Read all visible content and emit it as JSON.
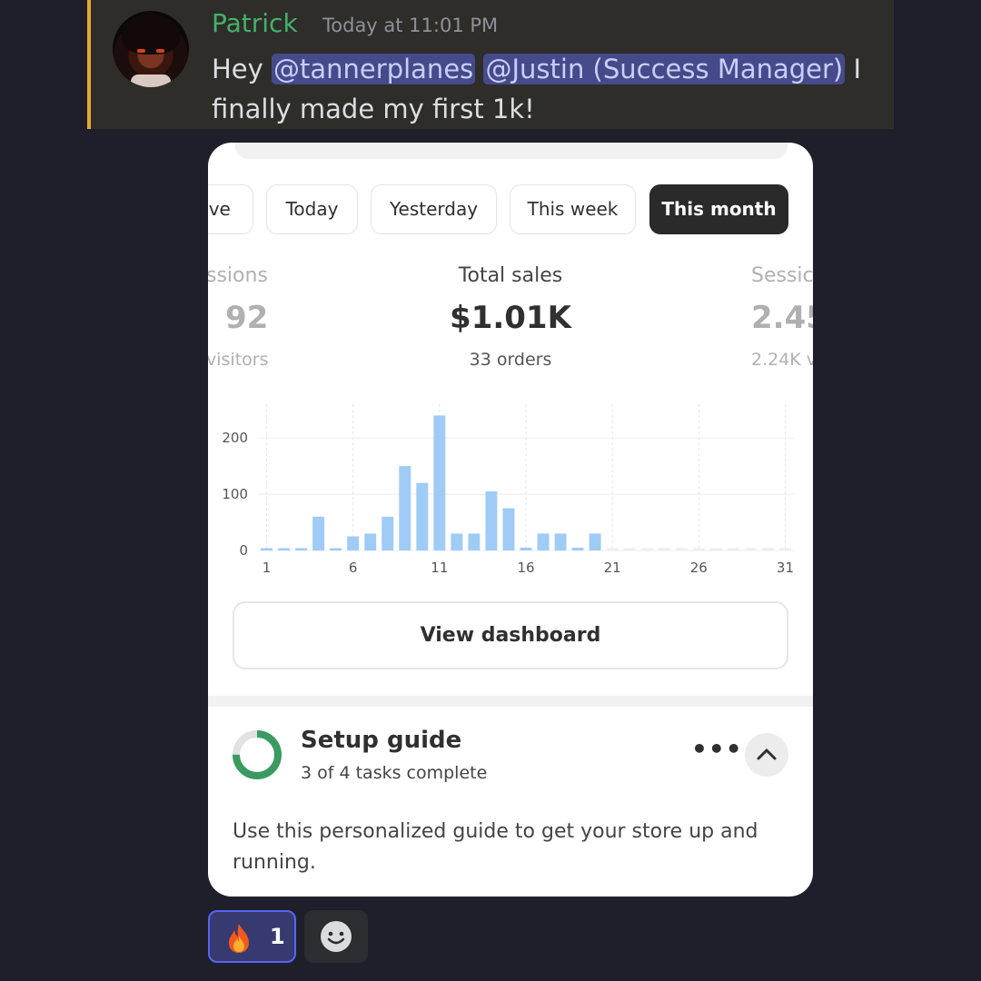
{
  "message": {
    "username": "Patrick",
    "timestamp": "Today at 11:01 PM",
    "text_before": "Hey ",
    "mentions": [
      "@tannerplanes",
      "@Justin (Success Manager)"
    ],
    "text_after": " I finally made my first 1k!"
  },
  "card": {
    "tabs": [
      {
        "label": "ive",
        "active": false
      },
      {
        "label": "Today",
        "active": false
      },
      {
        "label": "Yesterday",
        "active": false
      },
      {
        "label": "This week",
        "active": false
      },
      {
        "label": "This month",
        "active": true
      }
    ],
    "metrics": {
      "left": {
        "label": "ssions",
        "value": "92",
        "sub": "visitors"
      },
      "center": {
        "label": "Total sales",
        "value": "$1.01K",
        "sub": "33 orders"
      },
      "right": {
        "label": "Sessic",
        "value": "2.45",
        "sub": "2.24K v"
      }
    },
    "view_dashboard_label": "View dashboard",
    "setup": {
      "title": "Setup guide",
      "subtitle": "3 of 4 tasks complete",
      "progress": 0.75,
      "more_icon": "dots-horizontal-icon",
      "collapse_icon": "chevron-up-icon",
      "description": "Use this personalized guide to get your store up and running."
    }
  },
  "chart_data": {
    "type": "bar",
    "x": [
      1,
      2,
      3,
      4,
      5,
      6,
      7,
      8,
      9,
      10,
      11,
      12,
      13,
      14,
      15,
      16,
      17,
      18,
      19,
      20,
      21,
      22,
      23,
      24,
      25,
      26,
      27,
      28,
      29,
      30,
      31
    ],
    "values": [
      4,
      4,
      4,
      60,
      4,
      25,
      30,
      60,
      150,
      120,
      240,
      30,
      30,
      105,
      75,
      5,
      30,
      30,
      5,
      30,
      0,
      0,
      0,
      0,
      0,
      0,
      0,
      0,
      0,
      0,
      0
    ],
    "x_ticks": [
      "1",
      "6",
      "11",
      "16",
      "21",
      "26",
      "31"
    ],
    "y_ticks": [
      "0",
      "100",
      "200"
    ],
    "ylim": [
      0,
      260
    ],
    "color": "#9fcbf7",
    "grid": true
  },
  "reactions": {
    "fire_count": "1",
    "fire_icon": "fire-icon",
    "add_icon": "smiley-add-icon"
  },
  "colors": {
    "background": "#1e1f2a",
    "username": "#43b26a",
    "mention_bg": "#454a8a",
    "accent_bar": "#e8a830",
    "active_tab": "#2a2a2a",
    "progress_green": "#3a9b60"
  }
}
